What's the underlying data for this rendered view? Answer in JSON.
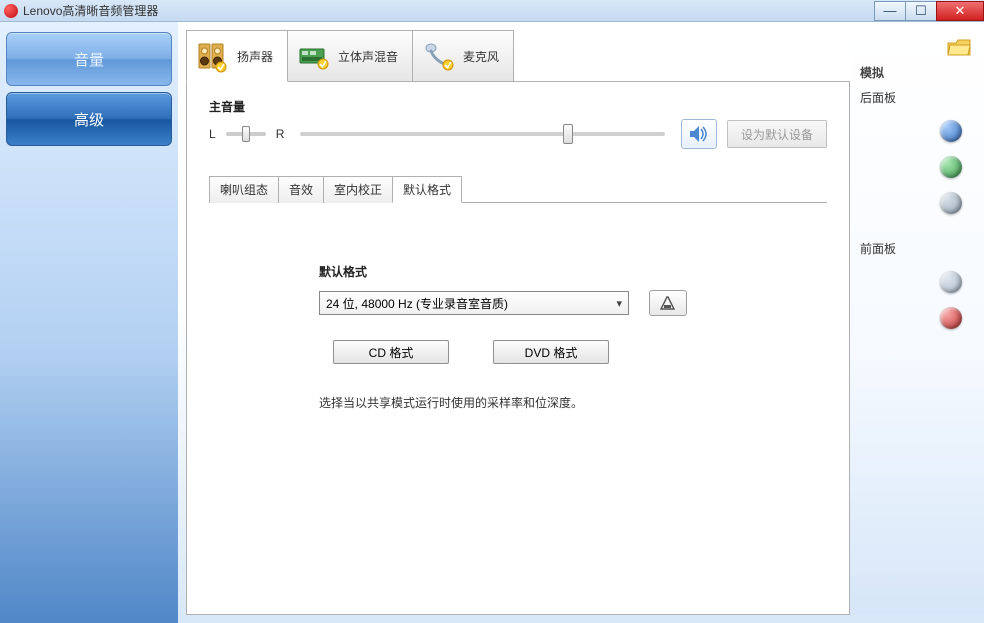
{
  "title": "Lenovo高清晰音频管理器",
  "sidebar": {
    "volume": "音量",
    "advanced": "高级"
  },
  "deviceTabs": {
    "speaker": "扬声器",
    "stereomix": "立体声混音",
    "mic": "麦克风"
  },
  "masterVolume": {
    "label": "主音量",
    "left": "L",
    "right": "R",
    "setDefault": "设为默认设备"
  },
  "subTabs": {
    "speakerConfig": "喇叭组态",
    "soundEffect": "音效",
    "roomCorrection": "室内校正",
    "defaultFormat": "默认格式"
  },
  "format": {
    "title": "默认格式",
    "selected": "24 位, 48000 Hz (专业录音室音质)",
    "cdBtn": "CD 格式",
    "dvdBtn": "DVD 格式",
    "desc": "选择当以共享模式运行时使用的采样率和位深度。"
  },
  "rightPanel": {
    "title": "模拟",
    "rearPanel": "后面板",
    "frontPanel": "前面板"
  }
}
